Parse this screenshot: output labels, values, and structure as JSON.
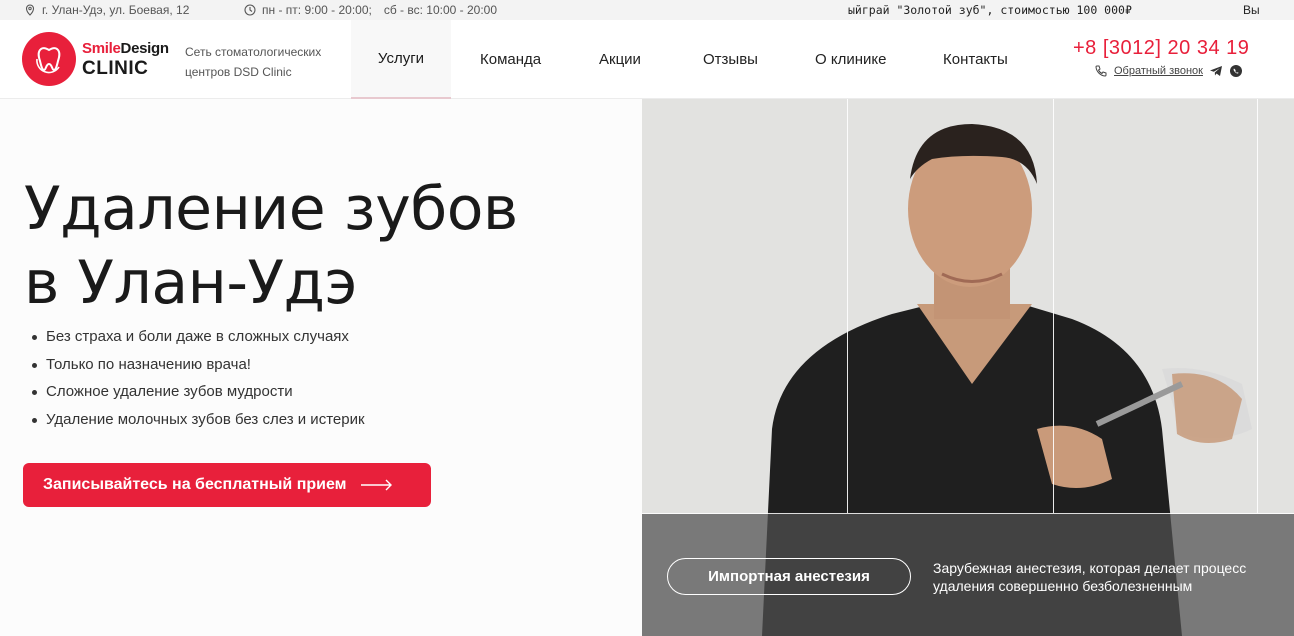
{
  "topbar": {
    "address": "г. Улан-Удэ, ул. Боевая, 12",
    "hours_weekdays": "пн - пт: 9:00 - 20:00;",
    "hours_weekend": "сб - вс: 10:00 - 20:00",
    "ticker": "ыйграй \"Золотой зуб\", стоимостью 100 000₽",
    "ticker_tail": "Вы"
  },
  "header": {
    "brand_line1_a": "Smile",
    "brand_line1_b": "Design",
    "brand_line2": "CLINIC",
    "tagline": "Сеть стоматологических центров DSD Clinic",
    "nav": [
      "Услуги",
      "Команда",
      "Акции",
      "Отзывы",
      "О клинике",
      "Контакты"
    ],
    "phone": "+8 [3012] 20 34 19",
    "callback": "Обратный звонок"
  },
  "hero": {
    "title_line1": "Удаление зубов",
    "title_line2": "в Улан-Удэ",
    "bullets": [
      "Без страха и боли даже в сложных случаях",
      "Только по назначению врача!",
      "Сложное удаление зубов мудрости",
      "Удаление молочных зубов без слез и истерик"
    ],
    "cta": "Записывайтесь на бесплатный прием",
    "feature_pill": "Импортная анестезия",
    "feature_text": "Зарубежная анестезия, которая делает процесс удаления совершенно безболезненным"
  },
  "colors": {
    "accent": "#e8203b"
  }
}
